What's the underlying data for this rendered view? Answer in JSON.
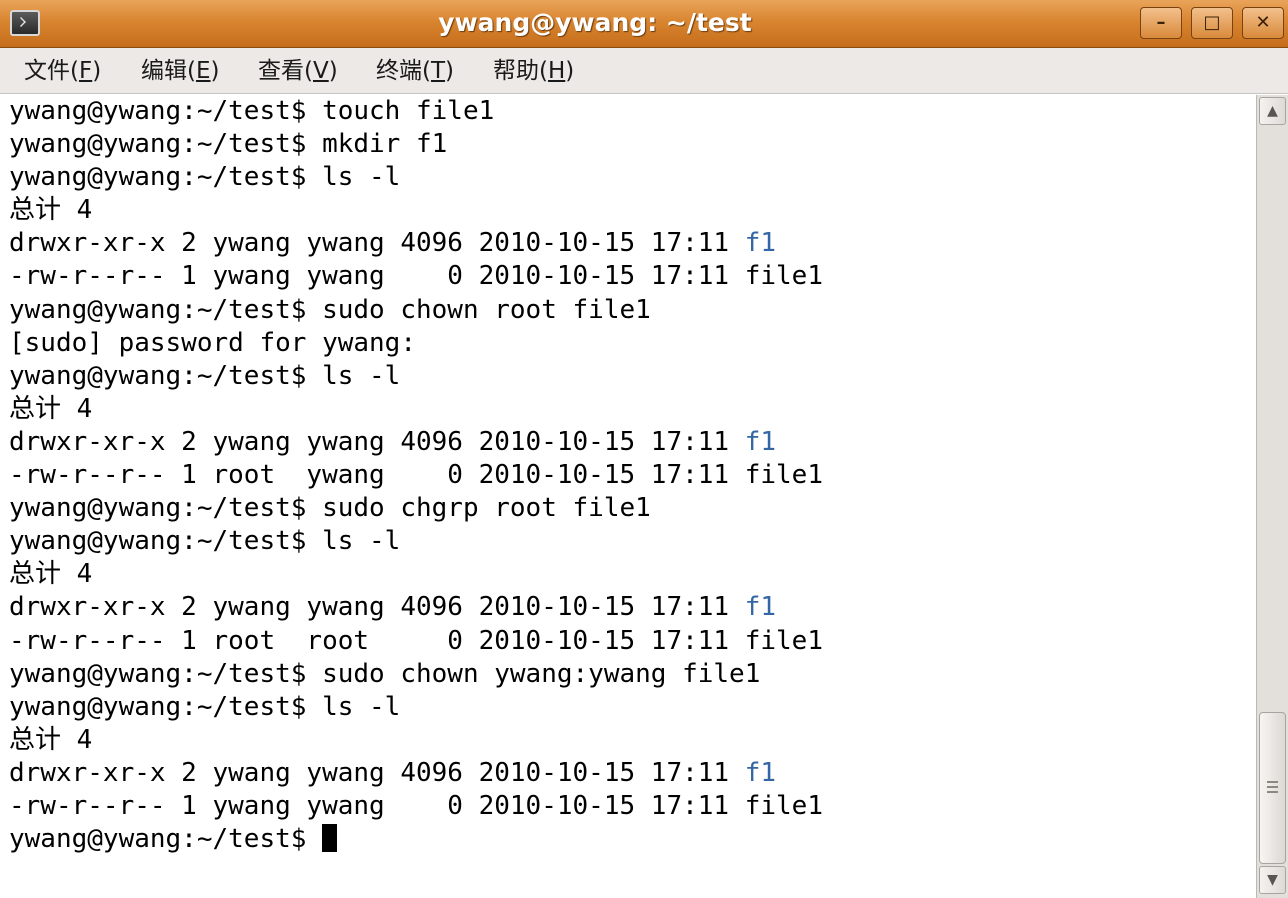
{
  "window": {
    "title": "ywang@ywang: ~/test",
    "buttons": {
      "minimize": "–",
      "maximize": "□",
      "close": "✕"
    }
  },
  "menu": [
    {
      "label": "文件(",
      "key": "F",
      "end": ")"
    },
    {
      "label": "编辑(",
      "key": "E",
      "end": ")"
    },
    {
      "label": "查看(",
      "key": "V",
      "end": ")"
    },
    {
      "label": "终端(",
      "key": "T",
      "end": ")"
    },
    {
      "label": "帮助(",
      "key": "H",
      "end": ")"
    }
  ],
  "terminal": {
    "lines": [
      {
        "text": "ywang@ywang:~/test$ touch file1"
      },
      {
        "text": "ywang@ywang:~/test$ mkdir f1"
      },
      {
        "text": "ywang@ywang:~/test$ ls -l"
      },
      {
        "text": "总计 4"
      },
      {
        "text": "drwxr-xr-x 2 ywang ywang 4096 2010-10-15 17:11 ",
        "dir": "f1"
      },
      {
        "text": "-rw-r--r-- 1 ywang ywang    0 2010-10-15 17:11 file1"
      },
      {
        "text": "ywang@ywang:~/test$ sudo chown root file1"
      },
      {
        "text": "[sudo] password for ywang:"
      },
      {
        "text": "ywang@ywang:~/test$ ls -l"
      },
      {
        "text": "总计 4"
      },
      {
        "text": "drwxr-xr-x 2 ywang ywang 4096 2010-10-15 17:11 ",
        "dir": "f1"
      },
      {
        "text": "-rw-r--r-- 1 root  ywang    0 2010-10-15 17:11 file1"
      },
      {
        "text": "ywang@ywang:~/test$ sudo chgrp root file1"
      },
      {
        "text": "ywang@ywang:~/test$ ls -l"
      },
      {
        "text": "总计 4"
      },
      {
        "text": "drwxr-xr-x 2 ywang ywang 4096 2010-10-15 17:11 ",
        "dir": "f1"
      },
      {
        "text": "-rw-r--r-- 1 root  root     0 2010-10-15 17:11 file1"
      },
      {
        "text": "ywang@ywang:~/test$ sudo chown ywang:ywang file1"
      },
      {
        "text": "ywang@ywang:~/test$ ls -l"
      },
      {
        "text": "总计 4"
      },
      {
        "text": "drwxr-xr-x 2 ywang ywang 4096 2010-10-15 17:11 ",
        "dir": "f1"
      },
      {
        "text": "-rw-r--r-- 1 ywang ywang    0 2010-10-15 17:11 file1"
      },
      {
        "text": "ywang@ywang:~/test$ ",
        "cursor": true
      }
    ],
    "colors": {
      "text": "#000000",
      "directory": "#3465a4",
      "background": "#ffffff"
    }
  },
  "icons": {
    "app": "terminal-icon",
    "scroll_up": "up-arrow-icon",
    "scroll_down": "down-arrow-icon",
    "scroll_grip": "grip-icon"
  },
  "theme": {
    "titlebar": "#d98530",
    "menubar": "#ece9e6"
  }
}
